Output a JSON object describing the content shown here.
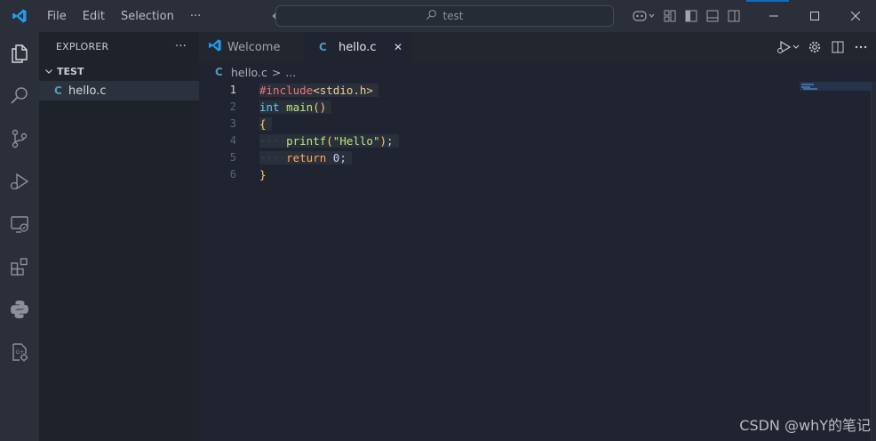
{
  "titlebar": {
    "menu": [
      "File",
      "Edit",
      "Selection",
      "···"
    ],
    "search_text": "test"
  },
  "sidebar": {
    "title": "EXPLORER",
    "more": "···",
    "section": "TEST",
    "files": [
      {
        "icon": "C",
        "name": "hello.c"
      }
    ]
  },
  "tabs": [
    {
      "label": "Welcome",
      "active": false
    },
    {
      "label": "hello.c",
      "active": true,
      "close": "✕"
    }
  ],
  "breadcrumb": {
    "icon": "C",
    "file": "hello.c",
    "sep": ">",
    "rest": "..."
  },
  "editor": {
    "line_numbers": [
      "1",
      "2",
      "3",
      "4",
      "5",
      "6"
    ],
    "active_line": "1",
    "lines": [
      {
        "a": "#include",
        "b": "<stdio.h>"
      },
      {
        "a": "int",
        "b": " ",
        "c": "main",
        "d": "()"
      },
      {
        "a": "{"
      },
      {
        "ws": "····",
        "a": "printf",
        "b": "(",
        "c": "\"Hello\"",
        "d": ")",
        "e": ";"
      },
      {
        "ws": "····",
        "a": "return",
        "b": " ",
        "c": "0",
        "d": ";"
      },
      {
        "a": "}"
      }
    ]
  },
  "watermark": "CSDN @whY的笔记",
  "colors": {
    "accent": "#0a6ec7",
    "c_file_icon": "#519aba",
    "background": "#1f2430"
  }
}
